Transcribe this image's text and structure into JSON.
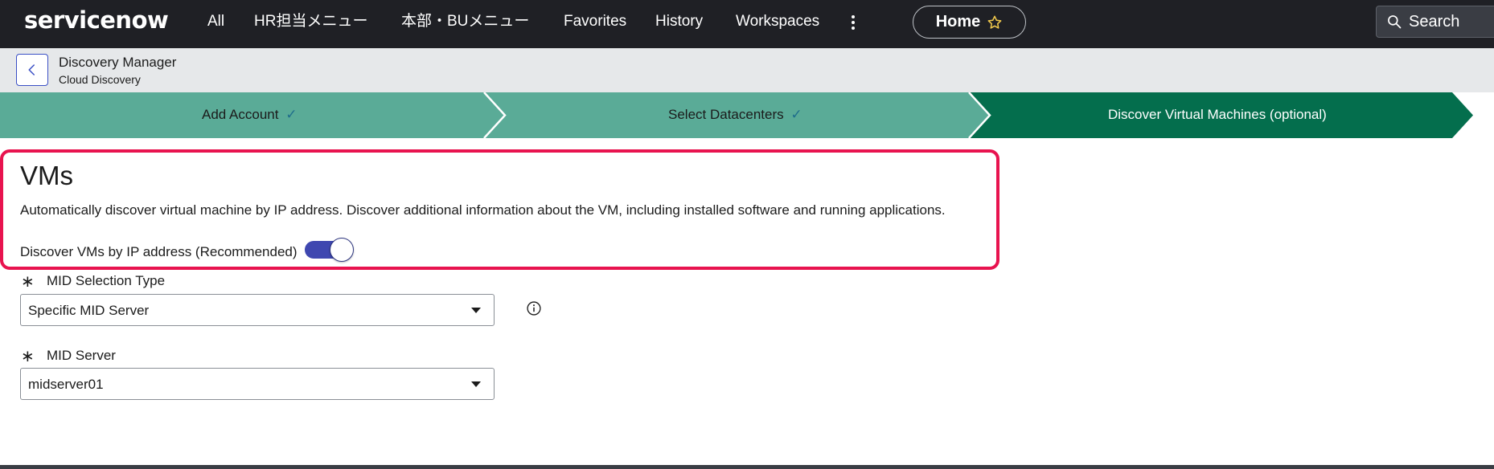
{
  "brand": {
    "logo_text": "servicenow"
  },
  "topnav": {
    "items": [
      {
        "label": "All"
      },
      {
        "label": "HR担当メニュー"
      },
      {
        "label": "本部・BUメニュー"
      },
      {
        "label": "Favorites"
      },
      {
        "label": "History"
      },
      {
        "label": "Workspaces"
      }
    ],
    "more_icon": "kebab-vertical-icon",
    "home_label": "Home",
    "home_icon": "star-outline-icon",
    "search_placeholder": "Search",
    "search_icon": "search-icon"
  },
  "subheader": {
    "back_icon": "chevron-left-icon",
    "title": "Discovery Manager",
    "subtitle": "Cloud Discovery"
  },
  "stepper": {
    "steps": [
      {
        "label": "Add Account",
        "status": "complete",
        "check": "✓"
      },
      {
        "label": "Select Datacenters",
        "status": "complete",
        "check": "✓"
      },
      {
        "label": "Discover Virtual Machines (optional)",
        "status": "current"
      }
    ],
    "colors": {
      "complete": "#5aab97",
      "current": "#046e4d"
    }
  },
  "vms": {
    "title": "VMs",
    "description": "Automatically discover virtual machine by IP address. Discover additional information about the VM, including installed software and running applications.",
    "toggle_label": "Discover VMs by IP address (Recommended)",
    "toggle_on": true
  },
  "fields": {
    "mid_selection_type": {
      "required_mark": "∗",
      "label": "MID Selection Type",
      "value": "Specific MID Server",
      "info_icon": "info-circle-icon"
    },
    "mid_server": {
      "required_mark": "∗",
      "label": "MID Server",
      "value": "midserver01"
    }
  },
  "colors": {
    "topnav_bg": "#1f2025",
    "highlight_border": "#e8134f",
    "toggle_on": "#3f47b0",
    "back_button_border": "#3a4fc5"
  }
}
